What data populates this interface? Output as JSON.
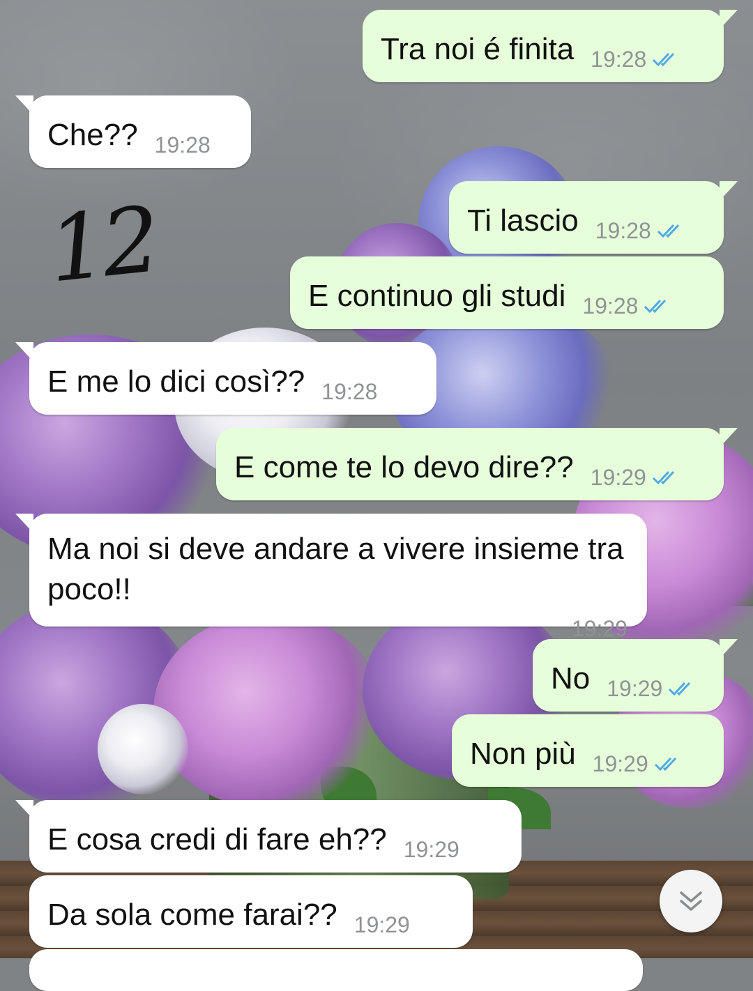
{
  "annotation": {
    "handwritten_number": "12"
  },
  "messages": [
    {
      "direction": "out",
      "text": "Tra noi é finita",
      "time": "19:28",
      "status": "read"
    },
    {
      "direction": "in",
      "text": "Che??",
      "time": "19:28"
    },
    {
      "direction": "out",
      "text": "Ti lascio",
      "time": "19:28",
      "status": "read"
    },
    {
      "direction": "out",
      "text": "E continuo gli studi",
      "time": "19:28",
      "status": "read"
    },
    {
      "direction": "in",
      "text": "E me lo dici così??",
      "time": "19:28"
    },
    {
      "direction": "out",
      "text": "E come te lo devo dire??",
      "time": "19:29",
      "status": "read"
    },
    {
      "direction": "in",
      "text": "Ma noi si deve andare a vivere insieme tra poco!!",
      "time": "19:29"
    },
    {
      "direction": "out",
      "text": "No",
      "time": "19:29",
      "status": "read"
    },
    {
      "direction": "out",
      "text": "Non più",
      "time": "19:29",
      "status": "read"
    },
    {
      "direction": "in",
      "text": "E cosa credi di fare eh??",
      "time": "19:29"
    },
    {
      "direction": "in",
      "text": "Da sola come farai??",
      "time": "19:29"
    }
  ],
  "colors": {
    "outgoing_bubble": "#e6ffda",
    "incoming_bubble": "#ffffff",
    "read_ticks": "#4fa9e8",
    "timestamp": "#8f9396"
  },
  "icons": {
    "read_receipt": "double-check-icon",
    "scroll_down": "double-chevron-down-icon"
  }
}
